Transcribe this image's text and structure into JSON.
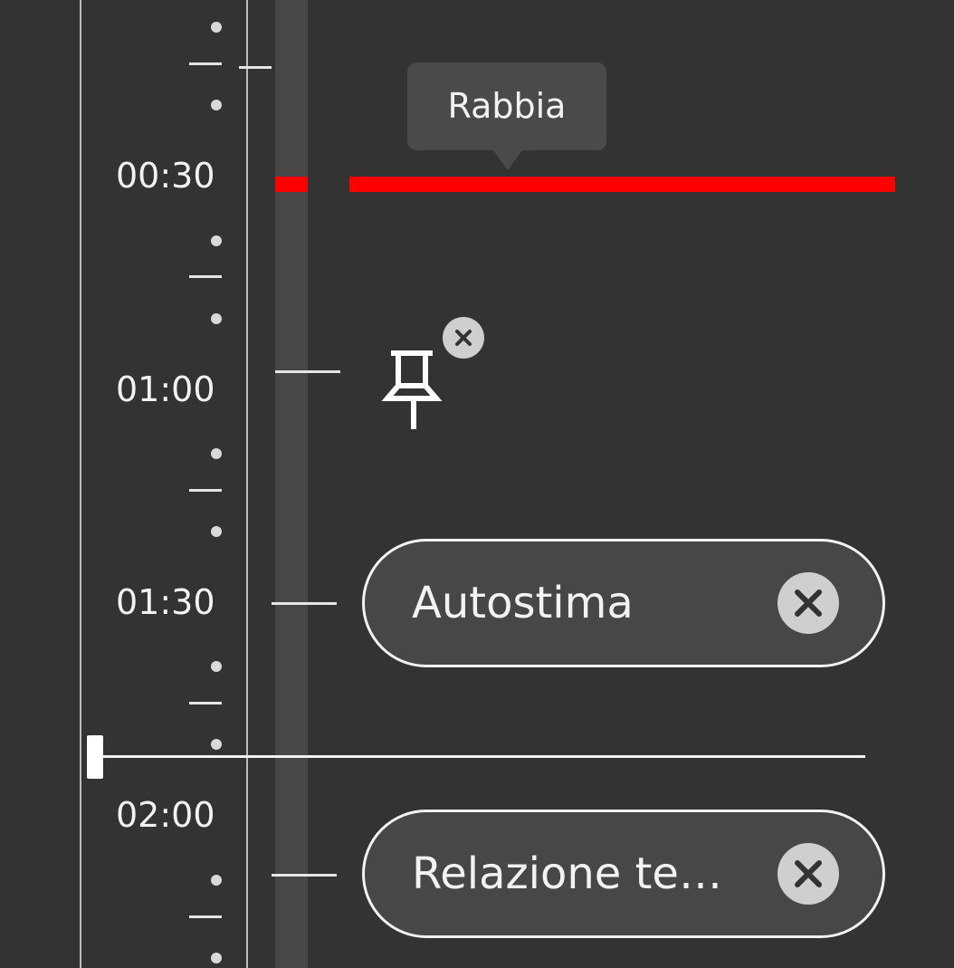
{
  "timeline": {
    "labels": [
      "00:30",
      "01:00",
      "01:30",
      "02:00"
    ]
  },
  "emotion_marker": {
    "tooltip": "Rabbia",
    "color": "#ff0000"
  },
  "pin": {
    "icon": "pushpin-icon",
    "remove_icon": "close-icon"
  },
  "tags": [
    {
      "label": "Autostima",
      "remove_icon": "close-icon"
    },
    {
      "label": "Relazione te…",
      "remove_icon": "close-icon"
    }
  ],
  "colors": {
    "background": "#333333",
    "track": "#474747",
    "accent": "#ff0000"
  }
}
